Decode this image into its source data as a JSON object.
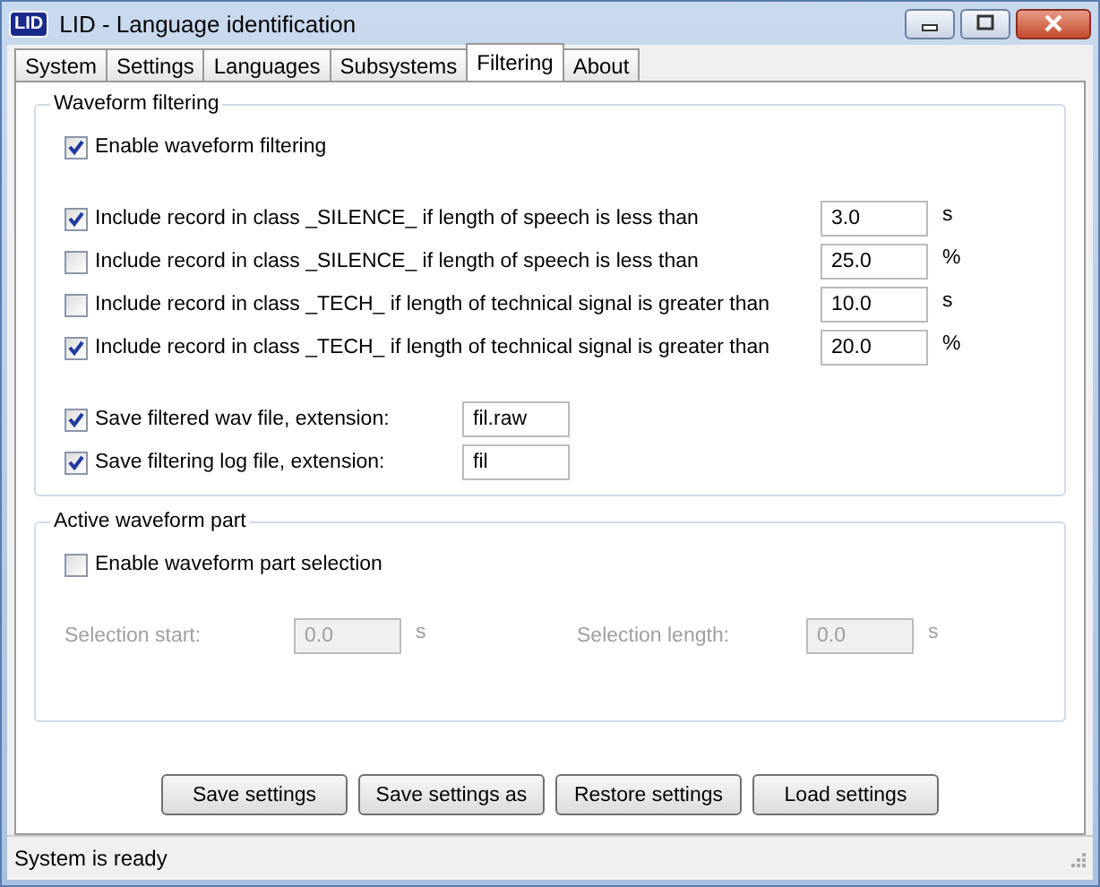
{
  "window": {
    "logo": "LID",
    "title": "LID - Language identification"
  },
  "tabs": [
    {
      "label": "System",
      "selected": false
    },
    {
      "label": "Settings",
      "selected": false
    },
    {
      "label": "Languages",
      "selected": false
    },
    {
      "label": "Subsystems",
      "selected": false
    },
    {
      "label": "Filtering",
      "selected": true
    },
    {
      "label": "About",
      "selected": false
    }
  ],
  "waveform_filtering": {
    "title": "Waveform filtering",
    "enable": {
      "label": "Enable waveform filtering",
      "checked": true
    },
    "rules": [
      {
        "label": "Include record in class _SILENCE_ if length of speech is less than",
        "checked": true,
        "value": "3.0",
        "unit": "s"
      },
      {
        "label": "Include record in class _SILENCE_ if length of speech is less than",
        "checked": false,
        "value": "25.0",
        "unit": "%"
      },
      {
        "label": "Include record in class _TECH_ if length of technical signal is greater than",
        "checked": false,
        "value": "10.0",
        "unit": "s"
      },
      {
        "label": "Include record in class _TECH_ if length of technical signal is greater than",
        "checked": true,
        "value": "20.0",
        "unit": "%"
      }
    ],
    "outputs": [
      {
        "label": "Save filtered wav file, extension:",
        "checked": true,
        "value": "fil.raw"
      },
      {
        "label": "Save filtering log file, extension:",
        "checked": true,
        "value": "fil"
      }
    ]
  },
  "active_waveform_part": {
    "title": "Active waveform part",
    "enable": {
      "label": "Enable waveform part selection",
      "checked": false
    },
    "fields": [
      {
        "label": "Selection start:",
        "value": "0.0",
        "unit": "s",
        "disabled": true
      },
      {
        "label": "Selection length:",
        "value": "0.0",
        "unit": "s",
        "disabled": true
      }
    ]
  },
  "buttons": [
    "Save settings",
    "Save settings as",
    "Restore settings",
    "Load settings"
  ],
  "status_bar": "System is ready"
}
